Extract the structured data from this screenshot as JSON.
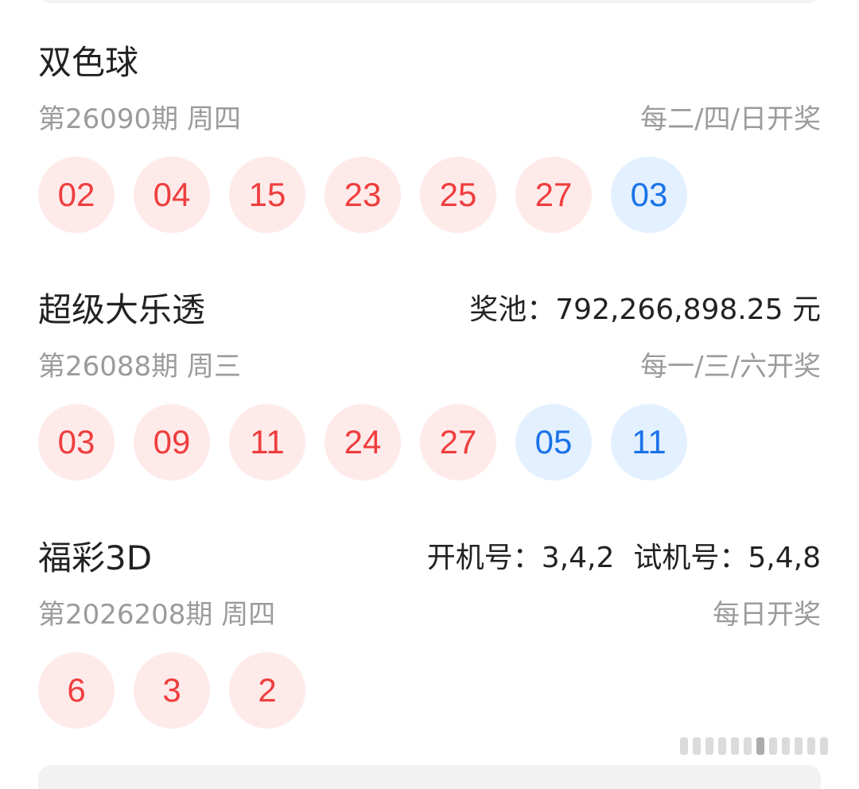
{
  "lotteries": [
    {
      "name": "双色球",
      "extra": "",
      "issue": "第26090期 周四",
      "schedule": "每二/四/日开奖",
      "balls": [
        {
          "num": "02",
          "color": "red"
        },
        {
          "num": "04",
          "color": "red"
        },
        {
          "num": "15",
          "color": "red"
        },
        {
          "num": "23",
          "color": "red"
        },
        {
          "num": "25",
          "color": "red"
        },
        {
          "num": "27",
          "color": "red"
        },
        {
          "num": "03",
          "color": "blue"
        }
      ]
    },
    {
      "name": "超级大乐透",
      "extra": "奖池：792,266,898.25 元",
      "issue": "第26088期 周三",
      "schedule": "每一/三/六开奖",
      "balls": [
        {
          "num": "03",
          "color": "red"
        },
        {
          "num": "09",
          "color": "red"
        },
        {
          "num": "11",
          "color": "red"
        },
        {
          "num": "24",
          "color": "red"
        },
        {
          "num": "27",
          "color": "red"
        },
        {
          "num": "05",
          "color": "blue"
        },
        {
          "num": "11",
          "color": "blue"
        }
      ]
    },
    {
      "name": "福彩3D",
      "extra_parts": [
        "开机号：3,4,2",
        "试机号：5,4,8"
      ],
      "issue": "第2026208期 周四",
      "schedule": "每日开奖",
      "balls": [
        {
          "num": "6",
          "color": "red"
        },
        {
          "num": "3",
          "color": "red"
        },
        {
          "num": "2",
          "color": "red"
        }
      ]
    }
  ],
  "colors": {
    "red_ball_bg": "#ffeaea",
    "red_ball_text": "#ef3e3e",
    "blue_ball_bg": "#e3f0ff",
    "blue_ball_text": "#1a73e8",
    "secondary_text": "#9b9b9b"
  }
}
